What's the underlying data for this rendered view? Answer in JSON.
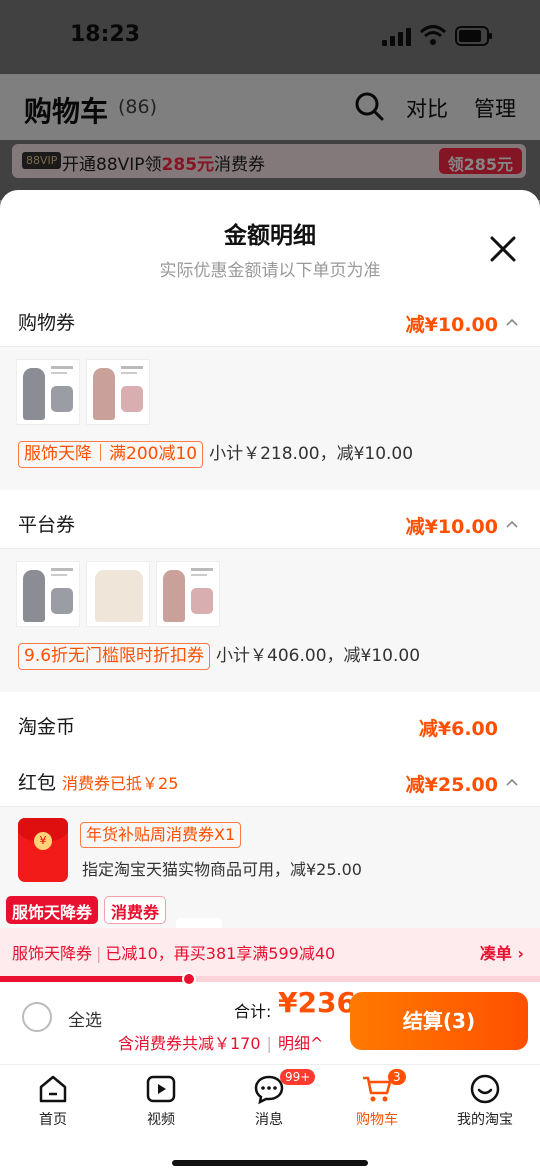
{
  "status_bar": {
    "time": "18:23"
  },
  "cart": {
    "title": "购物车",
    "count": "(86)",
    "compare_label": "对比",
    "manage_label": "管理",
    "vip_banner": {
      "badge": "88VIP",
      "text_prefix": "开通88VIP领",
      "amount": "285元",
      "text_suffix": "消费券",
      "button": "领285元"
    }
  },
  "sheet": {
    "title": "金额明细",
    "subtitle": "实际优惠金额请以下单页为准",
    "sections": [
      {
        "label": "购物券",
        "discount": "减¥10.00",
        "promo_tag": "服饰天降｜满200减10",
        "subtotal": "小计￥218.00，减¥10.00"
      },
      {
        "label": "平台券",
        "discount": "减¥10.00",
        "promo_tag": "9.6折无门槛限时折扣券",
        "subtotal": "小计￥406.00，减¥10.00"
      },
      {
        "label": "淘金币",
        "discount": "减¥6.00"
      },
      {
        "label": "红包",
        "note": "消费券已抵￥25",
        "discount": "减¥25.00"
      }
    ],
    "red_packet": {
      "tag": "年货补贴周消费券X1",
      "description": "指定淘宝天猫实物商品可用，减¥25.00"
    }
  },
  "float_tags": [
    "服饰天降券",
    "消费券"
  ],
  "promo_progress": {
    "name": "服饰天降券",
    "reduced": "已减10，再买381享满599减40",
    "link": "凑单 ›",
    "progress_ratio": 0.35
  },
  "checkout": {
    "select_all": "全选",
    "total_label": "合计:",
    "total_value": "¥236",
    "discount_summary": "含消费券共减￥170",
    "detail_link": "明细^",
    "pay_button": "结算(3)"
  },
  "tabs": [
    {
      "label": "首页",
      "icon": "home-icon"
    },
    {
      "label": "视频",
      "icon": "video-icon"
    },
    {
      "label": "消息",
      "icon": "message-icon",
      "badge": "99+"
    },
    {
      "label": "购物车",
      "icon": "cart-icon",
      "badge": "3",
      "active": true
    },
    {
      "label": "我的淘宝",
      "icon": "profile-icon"
    }
  ],
  "colors": {
    "accent": "#ff5000",
    "promo_red": "#e8102e"
  }
}
